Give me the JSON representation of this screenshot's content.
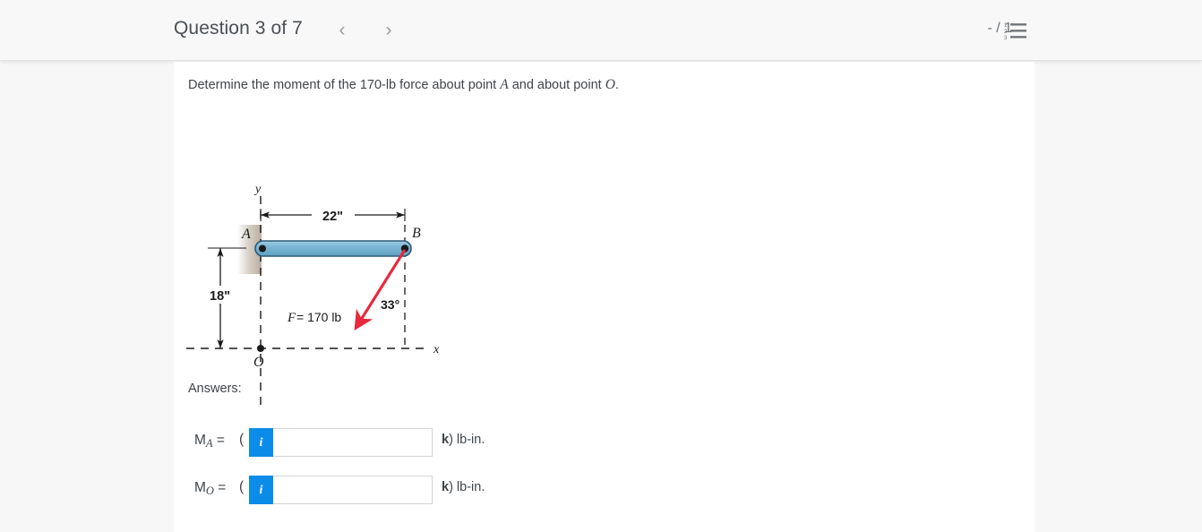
{
  "header": {
    "question_title": "Question 3 of 7",
    "prev_icon": "chevron-left-icon",
    "next_icon": "chevron-right-icon",
    "counter": "- / 1",
    "list_icon": "numbered-list-icon"
  },
  "prompt": {
    "text_before_a": "Determine the moment of the 170-lb force about point ",
    "point_a": "A",
    "text_between": " and about point ",
    "point_o": "O",
    "text_end": "."
  },
  "figure": {
    "axis_y_label": "y",
    "axis_x_label": "x",
    "label_a": "A",
    "label_b": "B",
    "label_o": "O",
    "dim_horizontal": "22\"",
    "dim_vertical": "18\"",
    "force_label_symbol": "F",
    "force_label_value": " = 170 lb",
    "angle_label": "33°",
    "beam_fill": "#7ab4d2",
    "beam_stroke": "#1f4d6b",
    "force_color": "#e8283c",
    "wall_color": "#cfc7bd"
  },
  "answers": {
    "section_label": "Answers:",
    "rows": [
      {
        "symbol": "M",
        "subscript": "A",
        "equals": " =",
        "open_paren": "(",
        "info_label": "i",
        "value": "",
        "placeholder": "",
        "unit_bold": "k",
        "unit_rest": ") lb-in."
      },
      {
        "symbol": "M",
        "subscript": "O",
        "equals": " =",
        "open_paren": "(",
        "info_label": "i",
        "value": "",
        "placeholder": "",
        "unit_bold": "k",
        "unit_rest": ") lb-in."
      }
    ]
  },
  "colors": {
    "accent_blue": "#0c8ce9",
    "page_background": "#f7f7f8",
    "card_background": "#ffffff",
    "topbar_background": "#f8f8f8"
  }
}
